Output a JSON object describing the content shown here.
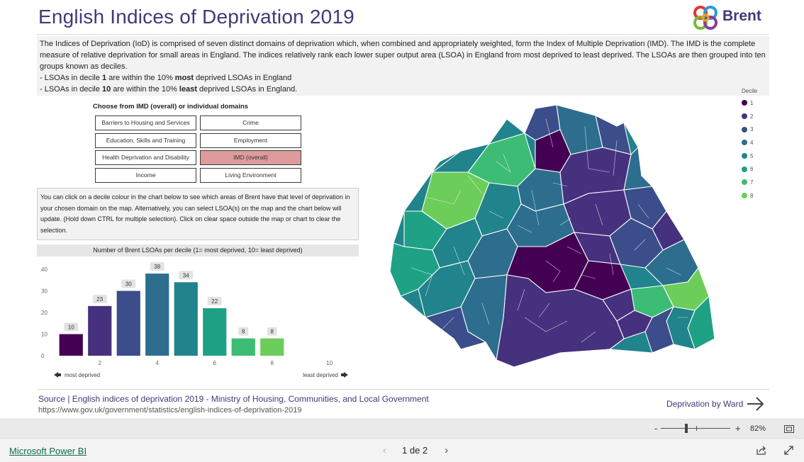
{
  "header": {
    "title": "English Indices of Deprivation 2019",
    "brand": "Brent"
  },
  "intro": {
    "paragraph": "The Indices of Deprivation (IoD) is comprised of seven distinct domains of deprivation which, when combined and appropriately weighted, form the Index of Multiple Deprivation (IMD). The IMD is the complete measure of relative deprivation for small areas in England. The indices relatively rank each lower super output area (LSOA) in England from most deprived to least deprived. The LSOAs are then grouped into ten groups known as deciles.",
    "bullet1": {
      "pre": " - LSOAs in decile ",
      "num": "1",
      "mid": " are within the 10% ",
      "emph": "most",
      "post": " deprived LSOAs in England"
    },
    "bullet2": {
      "pre": " - LSOAs in decile ",
      "num": "10",
      "mid": " are within the 10% ",
      "emph": "least",
      "post": " deprived LSOAs in England."
    }
  },
  "domains": {
    "heading": "Choose from IMD (overall) or individual domains",
    "barriers": "Barriers to Housing and Services",
    "crime": "Crime",
    "education": "Education, Skills and Training",
    "employment": "Employment",
    "health": "Health Deprivation and Disability",
    "imd": "IMD (overall)",
    "income": "Income",
    "living": "Living Environment",
    "selected": "IMD (overall)"
  },
  "help_text": "You can click on a decile colour in the chart below to see which areas of Brent have that level of deprivation in your chosen domain on the map. Alternatively, you can select LSOA(s) on the map and the chart below will update. (Hold down CTRL for multiple selection). Click on clear space outside the map or chart to clear the selection.",
  "chart_data": {
    "type": "bar",
    "title": "Number of Brent LSOAs per decile (1= most deprived, 10= least deprived)",
    "categories": [
      1,
      2,
      3,
      4,
      5,
      6,
      7,
      8
    ],
    "values": [
      10,
      23,
      30,
      38,
      34,
      22,
      8,
      8
    ],
    "colors": [
      "#440154",
      "#46317e",
      "#3b4d8a",
      "#2d6e8e",
      "#21838b",
      "#1fa186",
      "#3cbc75",
      "#6ccd5a"
    ],
    "xlim": [
      1,
      10
    ],
    "x_ticks": [
      2,
      4,
      6,
      8,
      10
    ],
    "ylim": [
      0,
      40
    ],
    "y_ticks": [
      0,
      10,
      20,
      30,
      40
    ],
    "grid": false,
    "x_left_label": "most deprived",
    "x_right_label": "least deprived"
  },
  "legend": {
    "title": "Decile",
    "items": [
      {
        "label": "1",
        "color": "#440154"
      },
      {
        "label": "2",
        "color": "#46317e"
      },
      {
        "label": "3",
        "color": "#3b4d8a"
      },
      {
        "label": "4",
        "color": "#2d6e8e"
      },
      {
        "label": "5",
        "color": "#21838b"
      },
      {
        "label": "6",
        "color": "#1fa186"
      },
      {
        "label": "7",
        "color": "#3cbc75"
      },
      {
        "label": "8",
        "color": "#6ccd5a"
      }
    ]
  },
  "footer_source": {
    "text": "Source | English indices of deprivation 2019 - Ministry of Housing, Communities, and Local Government",
    "url": "https://www.gov.uk/government/statistics/english-indices-of-deprivation-2019",
    "nav_link": "Deprivation by Ward"
  },
  "viewer": {
    "zoom_minus": "-",
    "zoom_plus": "+",
    "zoom_percent": "82%",
    "brand_link": "Microsoft Power BI",
    "page_indicator": "1 de 2",
    "zoom_level": 0.37
  }
}
